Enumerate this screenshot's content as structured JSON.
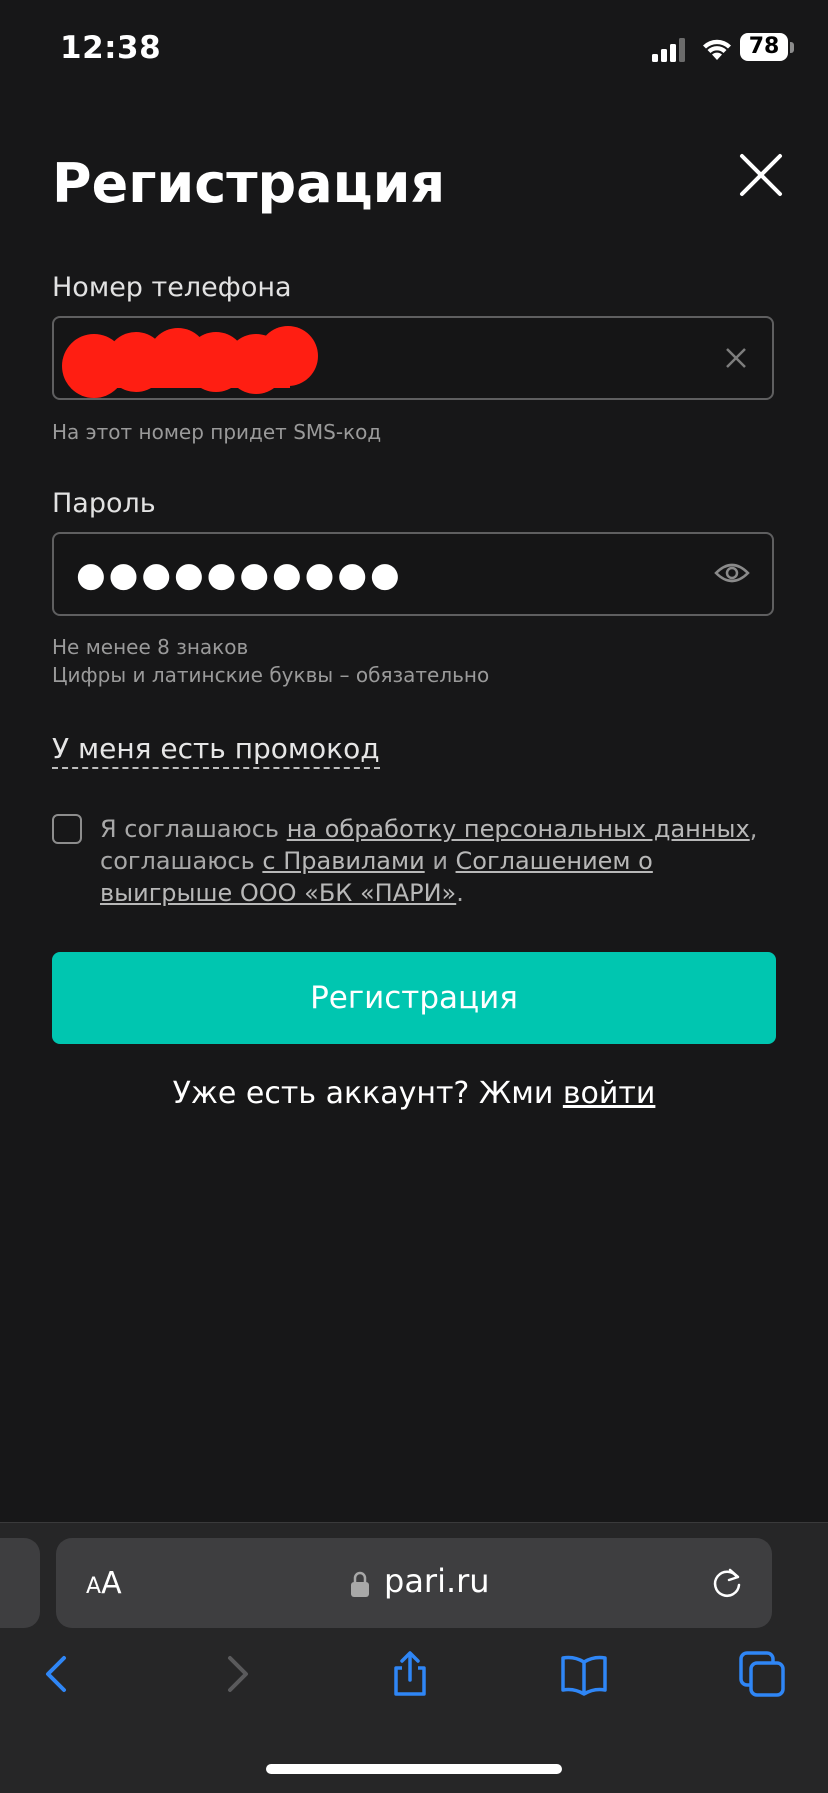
{
  "status_bar": {
    "time": "12:38",
    "battery": "78"
  },
  "form": {
    "title": "Регистрация",
    "phone_label": "Номер телефона",
    "phone_hint": "На этот номер придет SMS-код",
    "password_label": "Пароль",
    "password_value": "●●●●●●●●●●",
    "password_hint_1": "Не менее 8 знаков",
    "password_hint_2": "Цифры и латинские буквы – обязательно",
    "promo_link": "У меня есть промокод",
    "consent": {
      "prefix": "Я соглашаюсь ",
      "link_1": "на обработку персональных данных",
      "mid_1": ", соглашаюсь ",
      "link_2": "с Правилами",
      "mid_2": " и ",
      "link_3": "Соглашением о выигрыше ООО «БК «ПАРИ»",
      "suffix": "."
    },
    "submit_label": "Регистрация",
    "login_prompt": "Уже есть аккаунт? Жми ",
    "login_link": "войти"
  },
  "browser": {
    "text_size_small": "A",
    "text_size_big": "A",
    "url": "pari.ru"
  },
  "colors": {
    "accent": "#00c6b0",
    "background": "#171718",
    "redaction": "#ff1e12",
    "nav_blue": "#2f86f6"
  },
  "icons": [
    "close-icon",
    "clear-icon",
    "eye-icon",
    "lock-icon",
    "reload-icon",
    "back-icon",
    "forward-icon",
    "share-icon",
    "bookmarks-icon",
    "tabs-icon"
  ]
}
